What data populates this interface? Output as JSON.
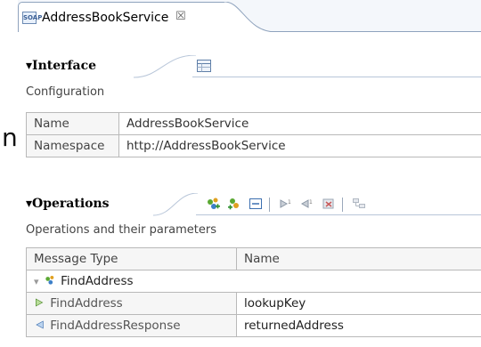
{
  "stray_glyph": "n",
  "tab": {
    "icon_text": "SOAP",
    "title": "AddressBookService",
    "close": "☒"
  },
  "interface": {
    "title": "Interface",
    "toggle": "▾",
    "subtitle": "Configuration",
    "rows": [
      {
        "key": "Name",
        "value": "AddressBookService"
      },
      {
        "key": "Namespace",
        "value": "http://AddressBookService"
      }
    ]
  },
  "operations": {
    "title": "Operations",
    "toggle": "▾",
    "subtitle": "Operations and their parameters",
    "columns": [
      "Message Type",
      "Name"
    ],
    "group": {
      "toggle": "▾",
      "name": "FindAddress"
    },
    "rows": [
      {
        "type": "FindAddress",
        "name": "lookupKey"
      },
      {
        "type": "FindAddressResponse",
        "name": "returnedAddress"
      }
    ]
  },
  "colors": {
    "accent": "#8fa3bd",
    "header_bg": "#f6f6f6",
    "grid": "#b9b9b9"
  }
}
